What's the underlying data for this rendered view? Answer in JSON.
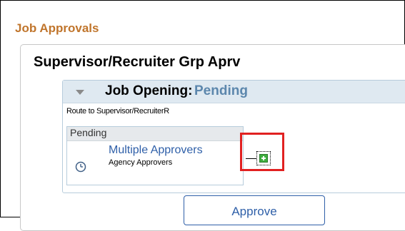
{
  "page": {
    "title": "Job Approvals"
  },
  "approval_group": {
    "title": "Supervisor/Recruiter Grp Aprv"
  },
  "stage": {
    "label": "Job Opening:",
    "status": "Pending",
    "route_text": "Route to Supervisor/RecruiterR"
  },
  "path": {
    "status": "Pending",
    "approver_name": "Multiple Approvers",
    "approver_role": "Agency Approvers",
    "status_icon": "clock-icon",
    "add_icon": "add-approver-icon"
  },
  "actions": {
    "approve_label": "Approve"
  },
  "colors": {
    "title": "#c0752c",
    "stage_status": "#5c87ad",
    "link": "#2e5fa8",
    "highlight": "#e12121"
  }
}
